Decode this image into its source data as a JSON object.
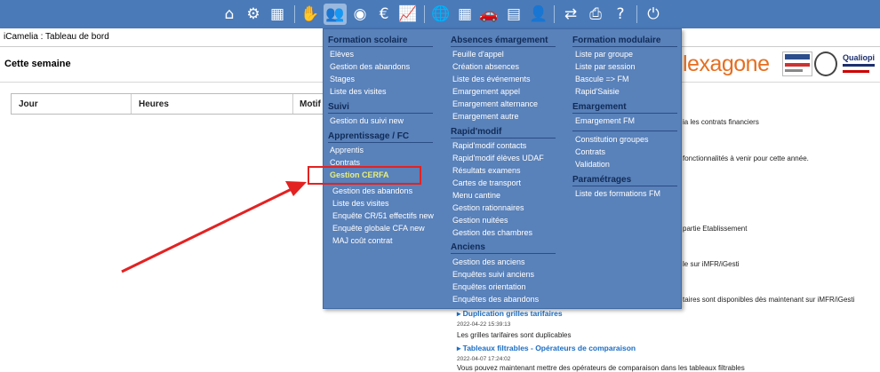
{
  "topbar": {
    "icons": [
      {
        "name": "home-icon",
        "glyph": "⌂"
      },
      {
        "name": "settings-cogs-icon",
        "glyph": "⚙"
      },
      {
        "name": "buildings-icon",
        "glyph": "▦"
      },
      {
        "name": "handshake-icon",
        "glyph": "✋"
      },
      {
        "name": "users-icon",
        "glyph": "👥"
      },
      {
        "name": "palette-icon",
        "glyph": "◉"
      },
      {
        "name": "euro-icon",
        "glyph": "€"
      },
      {
        "name": "line-chart-icon",
        "glyph": "📈"
      },
      {
        "name": "globe-icon",
        "glyph": "🌐"
      },
      {
        "name": "calendar-icon",
        "glyph": "▦"
      },
      {
        "name": "car-icon",
        "glyph": "🚗"
      },
      {
        "name": "id-card-icon",
        "glyph": "▤"
      },
      {
        "name": "user-clock-icon",
        "glyph": "👤"
      },
      {
        "name": "inbox-transfer-icon",
        "glyph": "⇄"
      },
      {
        "name": "print-icon",
        "glyph": "⎙"
      },
      {
        "name": "help-icon",
        "glyph": "?"
      },
      {
        "name": "power-icon",
        "glyph": "⏻"
      }
    ]
  },
  "page_title": "iCamelia : Tableau de bord",
  "week_label": "Cette semaine",
  "table": {
    "headers": [
      "Jour",
      "Heures",
      "Motif"
    ]
  },
  "logo_text": "lexagone",
  "qualiopi_text": "Qualiopi",
  "news": {
    "fragments": [
      "ia les contrats financiers",
      "fonctionnalités à venir pour cette année.",
      "partie Etablissement",
      "le sur iMFR/iGesti",
      "taires sont disponibles dès maintenant sur iMFR/iGesti"
    ],
    "items": [
      {
        "title": "Duplication grilles tarifaires",
        "date": "2022-04-22 15:39:13",
        "text": "Les grilles tarifaires sont duplicables"
      },
      {
        "title": "Tableaux filtrables - Opérateurs de comparaison",
        "date": "2022-04-07 17:24:02",
        "text": "Vous pouvez maintenant mettre des opérateurs de comparaison dans les tableaux filtrables"
      }
    ]
  },
  "menu": {
    "col1": {
      "formation_scolaire": {
        "heading": "Formation scolaire",
        "items": [
          "Elèves",
          "Gestion des abandons",
          "Stages",
          "Liste des visites"
        ]
      },
      "suivi": {
        "heading": "Suivi",
        "items": [
          "Gestion du suivi new"
        ]
      },
      "apprentissage": {
        "heading": "Apprentissage / FC",
        "items": [
          "Apprentis",
          "Contrats",
          "Gestion CERFA",
          "Gestion des abandons",
          "Liste des visites",
          "Enquête CR/51 effectifs new",
          "Enquête globale CFA new",
          "MAJ coût contrat"
        ]
      }
    },
    "col2": {
      "absences": {
        "heading": "Absences émargement",
        "items": [
          "Feuille d'appel",
          "Création absences",
          "Liste des événements",
          "Emargement appel",
          "Emargement alternance",
          "Emargement autre"
        ]
      },
      "rapidmodif": {
        "heading": "Rapid'modif",
        "items": [
          "Rapid'modif contacts",
          "Rapid'modif élèves UDAF",
          "Résultats examens",
          "Cartes de transport",
          "Menu cantine",
          "Gestion rationnaires",
          "Gestion nuitées",
          "Gestion des chambres"
        ]
      },
      "anciens": {
        "heading": "Anciens",
        "items": [
          "Gestion des anciens",
          "Enquêtes suivi anciens",
          "Enquêtes orientation",
          "Enquêtes des abandons"
        ]
      }
    },
    "col3": {
      "modulaire": {
        "heading": "Formation modulaire",
        "items": [
          "Liste par groupe",
          "Liste par session",
          "Bascule => FM",
          "Rapid'Saisie"
        ]
      },
      "emargement": {
        "heading": "Emargement",
        "items": [
          "Emargement FM"
        ]
      },
      "groupes": {
        "items": [
          "Constitution groupes",
          "Contrats",
          "Validation"
        ]
      },
      "parametrages": {
        "heading": "Paramétrages",
        "items": [
          "Liste des formations FM"
        ]
      }
    }
  },
  "colors": {
    "topbar": "#4a7ab8",
    "menu_bg": "#5981ba",
    "highlight_box": "#e32222",
    "arrow": "#e32222",
    "logo": "#e56f22"
  }
}
